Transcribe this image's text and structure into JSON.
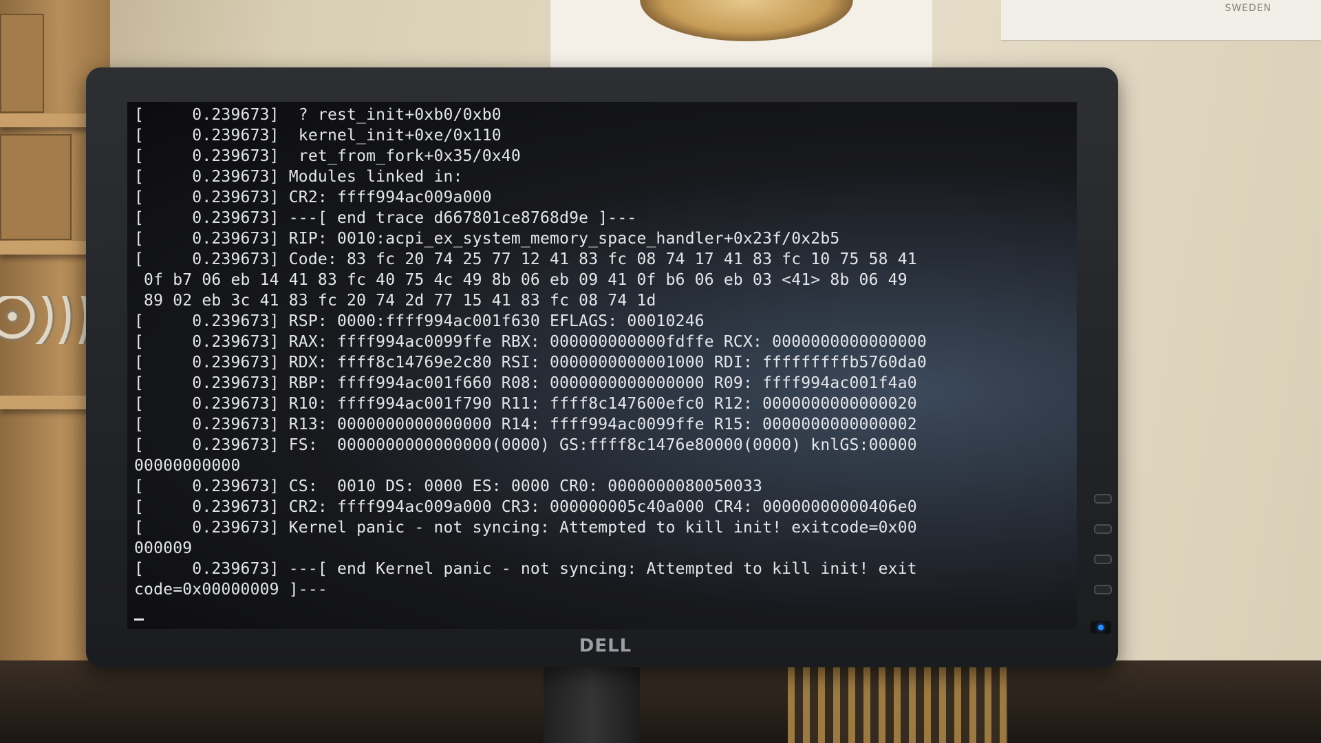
{
  "environment": {
    "sign_text": "SWEDEN"
  },
  "monitor": {
    "brand_logo": "DELL",
    "power_led_color": "#2e8cff"
  },
  "console": {
    "lines": [
      "[     0.239673]  ? rest_init+0xb0/0xb0",
      "[     0.239673]  kernel_init+0xe/0x110",
      "[     0.239673]  ret_from_fork+0x35/0x40",
      "[     0.239673] Modules linked in:",
      "[     0.239673] CR2: ffff994ac009a000",
      "[     0.239673] ---[ end trace d667801ce8768d9e ]---",
      "[     0.239673] RIP: 0010:acpi_ex_system_memory_space_handler+0x23f/0x2b5",
      "[     0.239673] Code: 83 fc 20 74 25 77 12 41 83 fc 08 74 17 41 83 fc 10 75 58 41",
      " 0f b7 06 eb 14 41 83 fc 40 75 4c 49 8b 06 eb 09 41 0f b6 06 eb 03 <41> 8b 06 49",
      " 89 02 eb 3c 41 83 fc 20 74 2d 77 15 41 83 fc 08 74 1d",
      "[     0.239673] RSP: 0000:ffff994ac001f630 EFLAGS: 00010246",
      "[     0.239673] RAX: ffff994ac0099ffe RBX: 000000000000fdffe RCX: 0000000000000000",
      "[     0.239673] RDX: ffff8c14769e2c80 RSI: 0000000000001000 RDI: fffffffffb5760da0",
      "[     0.239673] RBP: ffff994ac001f660 R08: 0000000000000000 R09: ffff994ac001f4a0",
      "[     0.239673] R10: ffff994ac001f790 R11: ffff8c147600efc0 R12: 0000000000000020",
      "[     0.239673] R13: 0000000000000000 R14: ffff994ac0099ffe R15: 0000000000000002",
      "[     0.239673] FS:  0000000000000000(0000) GS:ffff8c1476e80000(0000) knlGS:00000",
      "00000000000",
      "[     0.239673] CS:  0010 DS: 0000 ES: 0000 CR0: 0000000080050033",
      "[     0.239673] CR2: ffff994ac009a000 CR3: 000000005c40a000 CR4: 00000000000406e0",
      "[     0.239673] Kernel panic - not syncing: Attempted to kill init! exitcode=0x00",
      "000009",
      "[     0.239673] ---[ end Kernel panic - not syncing: Attempted to kill init! exit",
      "code=0x00000009 ]---"
    ]
  }
}
